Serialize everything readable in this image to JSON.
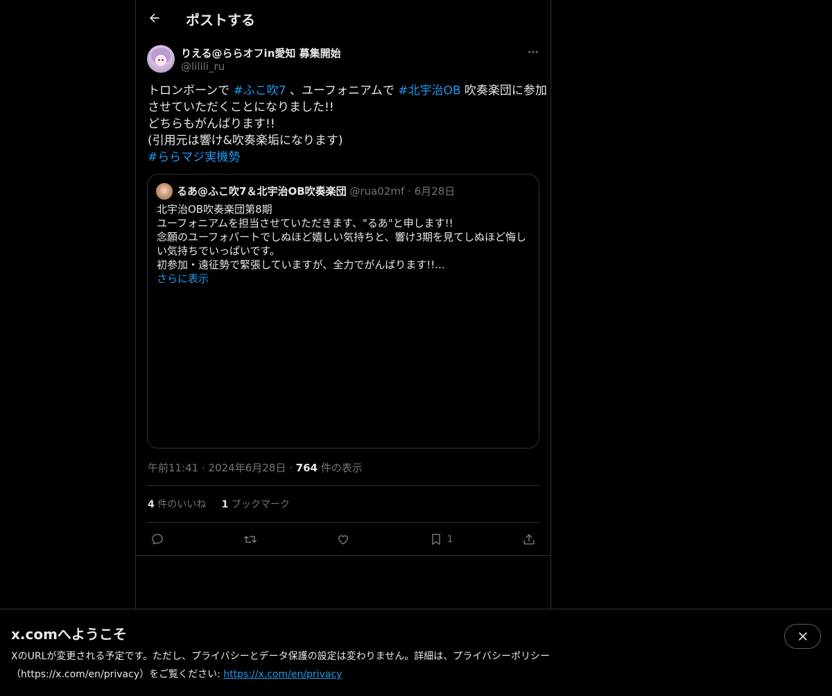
{
  "header": {
    "title": "ポストする"
  },
  "post": {
    "author_name": "りえる@ららオフin愛知 募集開始",
    "author_handle": "@lilili_ru",
    "text": {
      "l1_a": "トロンボーンで ",
      "l1_tag1": "#ふこ吹7",
      "l1_b": " 、ユーフォニアムで ",
      "l1_tag2": "#北宇治OB",
      "l1_c": " 吹奏楽団に参加",
      "l2": "させていただくことになりました!!",
      "l3": "どちらもがんばります!!",
      "l4": "(引用元は響け&吹奏楽垢になります)",
      "l5_tag": "#ららマジ実機勢"
    },
    "quote": {
      "name": "るあ@ふこ吹7＆北宇治OB吹奏楽団",
      "handle": "@rua02mf",
      "dot": "·",
      "date": "6月28日",
      "lines": [
        "北宇治OB吹奏楽団第8期",
        "ユーフォニアムを担当させていただきます、\"るあ\"と申します!!",
        "念願のユーフォパートでしぬほど嬉しい気持ちと、響け3期を見てしぬほど悔し",
        "い気持ちでいっぱいです。",
        "初参加・遠征勢で緊張していますが、全力でがんばります!!..."
      ],
      "show_more": "さらに表示"
    },
    "meta": {
      "time": "午前11:41",
      "sep1": " · ",
      "date": "2024年6月28日",
      "sep2": " · ",
      "views": "764",
      "views_label": " 件の表示"
    },
    "stats": {
      "likes": "4",
      "likes_label": " 件のいいね",
      "bookmarks": "1",
      "bookmarks_label": " ブックマーク"
    },
    "actions": {
      "bookmark_count": "1"
    }
  },
  "banner": {
    "title": "x.comへようこそ",
    "text": "XのURLが変更される予定です。ただし、プライバシーとデータ保護の設定は変わりません。詳細は、プライバシーポリシー（https://x.com/en/privacy）をご覧ください: ",
    "link": "https://x.com/en/privacy"
  },
  "colors": {
    "accent": "#1d9bf0",
    "muted": "#71767b",
    "border": "#2f3336",
    "text": "#e7e9ea",
    "background": "#000000"
  },
  "icons": [
    "back-arrow-icon",
    "more-icon",
    "reply-icon",
    "retweet-icon",
    "like-icon",
    "bookmark-icon",
    "share-icon",
    "close-icon"
  ]
}
